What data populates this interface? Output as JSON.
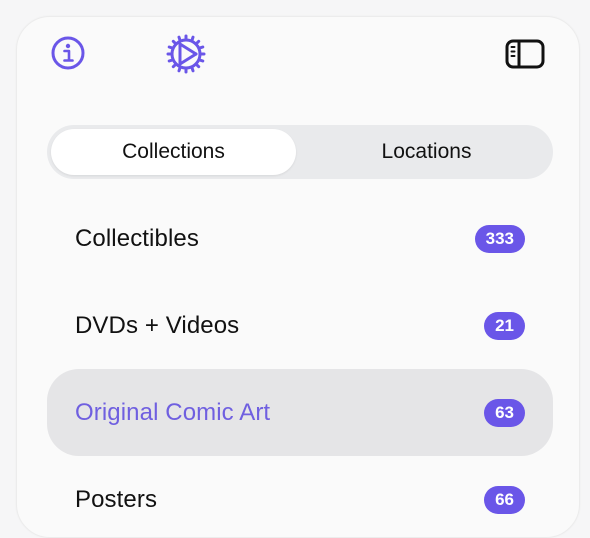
{
  "toolbar": {
    "info_icon": "info-circle-icon",
    "settings_icon": "gear-icon",
    "sidebar_icon": "sidebar-toggle-icon",
    "accent_color": "#6a56e8"
  },
  "segmented_control": {
    "options": [
      {
        "label": "Collections",
        "selected": true
      },
      {
        "label": "Locations",
        "selected": false
      }
    ]
  },
  "collections": [
    {
      "label": "Collectibles",
      "count": "333",
      "selected": false
    },
    {
      "label": "DVDs + Videos",
      "count": "21",
      "selected": false
    },
    {
      "label": "Original Comic Art",
      "count": "63",
      "selected": true
    },
    {
      "label": "Posters",
      "count": "66",
      "selected": false
    }
  ]
}
